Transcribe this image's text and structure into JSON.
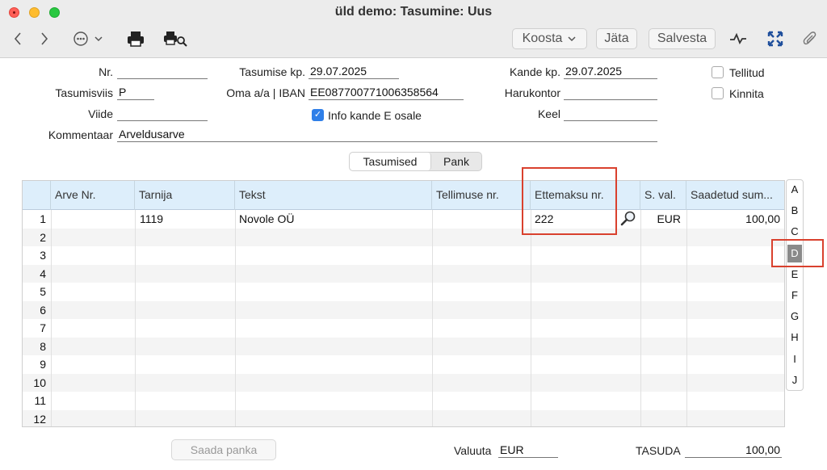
{
  "window": {
    "title": "üld demo: Tasumine: Uus"
  },
  "toolbar": {
    "koosta_label": "Koosta",
    "jata_label": "Jäta",
    "salvesta_label": "Salvesta"
  },
  "form": {
    "nr": {
      "label": "Nr.",
      "value": ""
    },
    "tasumisviis": {
      "label": "Tasumisviis",
      "value": "P"
    },
    "viide": {
      "label": "Viide",
      "value": ""
    },
    "kommentaar": {
      "label": "Kommentaar",
      "value": "Arveldusarve"
    },
    "tasumise_kp": {
      "label": "Tasumise kp.",
      "value": "29.07.2025"
    },
    "oma_iban": {
      "label": "Oma a/a | IBAN",
      "value": "EE087700771006358564"
    },
    "info_kande": {
      "label": "Info kande E osale",
      "checked": true
    },
    "kande_kp": {
      "label": "Kande kp.",
      "value": "29.07.2025"
    },
    "harukontor": {
      "label": "Harukontor",
      "value": ""
    },
    "keel": {
      "label": "Keel",
      "value": ""
    },
    "tellitud": {
      "label": "Tellitud",
      "checked": false
    },
    "kinnita": {
      "label": "Kinnita",
      "checked": false
    }
  },
  "tabs": {
    "tasumised": "Tasumised",
    "pank": "Pank",
    "active": "Tasumised"
  },
  "table": {
    "columns": [
      "Arve Nr.",
      "Tarnija",
      "Tekst",
      "Tellimuse nr.",
      "Ettemaksu nr.",
      "S. val.",
      "Saadetud sum..."
    ],
    "row_numbers": [
      "1",
      "2",
      "3",
      "4",
      "5",
      "6",
      "7",
      "8",
      "9",
      "10",
      "11",
      "12"
    ],
    "rows": [
      {
        "arve_nr": "",
        "tarnija": "1119",
        "tekst": "Novole OÜ",
        "tellimuse_nr": "",
        "ettemaksu_nr": "222",
        "s_val": "EUR",
        "saadetud_sum": "100,00"
      }
    ]
  },
  "letters": [
    "A",
    "B",
    "C",
    "D",
    "E",
    "F",
    "G",
    "H",
    "I",
    "J"
  ],
  "selected_letter": "D",
  "footer": {
    "saada_panka": "Saada panka",
    "valuuta_label": "Valuuta",
    "valuuta_value": "EUR",
    "tasuda_label": "TASUDA",
    "tasuda_value": "100,00"
  },
  "colors": {
    "header_bg": "#ddeefb",
    "highlight": "#d9412e",
    "checkbox_accent": "#2f7fe8"
  }
}
